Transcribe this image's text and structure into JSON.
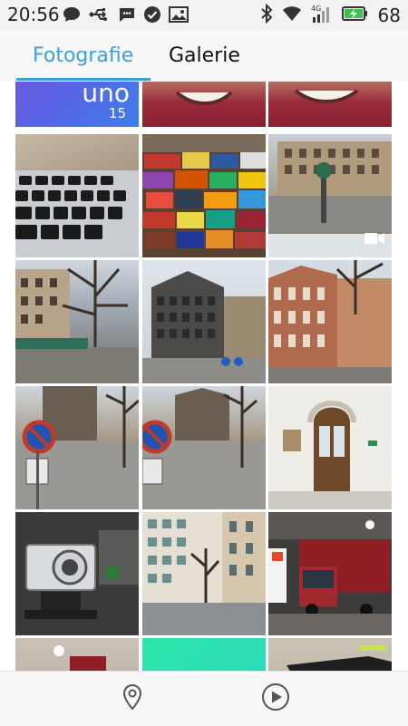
{
  "status_bar": {
    "time": "20:56",
    "battery_level": "68",
    "left_icons": [
      "chat-icon",
      "usb-icon",
      "message-icon",
      "check-circle-icon",
      "image-icon"
    ],
    "right_icons": [
      "bluetooth-icon",
      "wifi-icon",
      "cellular-4g-icon",
      "battery-charging-icon"
    ]
  },
  "tabs": [
    {
      "label": "Fotografie",
      "active": true
    },
    {
      "label": "Galerie",
      "active": false
    }
  ],
  "accent_color": "#3aa1d8",
  "album": {
    "name": "uno",
    "count": "15"
  },
  "grid": {
    "rows": [
      [
        "album-uno",
        "photo-smiling-face",
        "photo-smiling-face"
      ],
      [
        "photo-laptop-keyboard",
        "photo-candy-shelf",
        "video-street-construction"
      ],
      [
        "photo-street-trees",
        "photo-dark-building-corner",
        "photo-ornate-building"
      ],
      [
        "photo-street-no-parking-sign",
        "photo-street-no-parking-sign",
        "photo-wooden-door"
      ],
      [
        "photo-action-camera",
        "photo-apartment-block",
        "photo-truck-garage"
      ],
      [
        "photo-ceiling-lamp",
        "photo-teal",
        "photo-phone-on-table"
      ]
    ]
  },
  "bottom_bar": {
    "buttons": [
      "location-pin-icon",
      "play-icon"
    ]
  }
}
